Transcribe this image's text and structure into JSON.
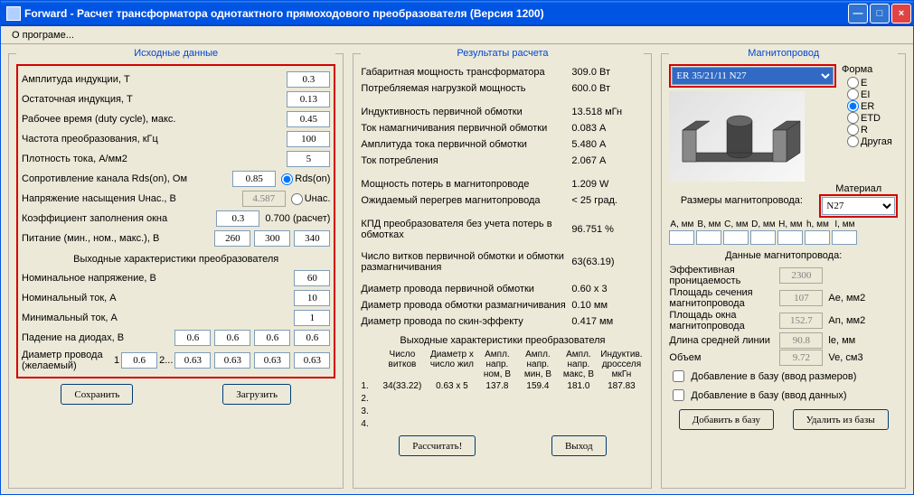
{
  "titlebar": "Forward - Расчет трансформатора однотактного прямоходового преобразователя (Версия 1200)",
  "menu": {
    "about": "О програме..."
  },
  "legends": {
    "input": "Исходные данные",
    "results": "Результаты расчета",
    "core": "Магнитопровод"
  },
  "input": {
    "rows": [
      {
        "label": "Амплитуда индукции, Т",
        "value": "0.3"
      },
      {
        "label": "Остаточная индукция, Т",
        "value": "0.13"
      },
      {
        "label": "Рабочее время (duty cycle), макс.",
        "value": "0.45"
      },
      {
        "label": "Частота преобразования, кГц",
        "value": "100"
      },
      {
        "label": "Плотность тока, А/мм2",
        "value": "5"
      },
      {
        "label": "Сопротивление канала Rds(on), Ом",
        "value": "0.85"
      },
      {
        "label": "Напряжение насыщения Uнас., В",
        "value": "4.587",
        "readonly": true
      },
      {
        "label": "Коэффициент заполнения окна",
        "value": "0.3",
        "extra": "0.700 (расчет)"
      },
      {
        "label": "Питание (мин., ном., макс.), В",
        "values": [
          "260",
          "300",
          "340"
        ]
      }
    ],
    "rds_label": "Rds(on)",
    "unas_label": "Uнас.",
    "out_head": "Выходные характеристики преобразователя",
    "out_rows": [
      {
        "label": "Номинальное напряжение, В",
        "values": [
          "60"
        ]
      },
      {
        "label": "Номинальный ток, А",
        "values": [
          "10"
        ]
      },
      {
        "label": "Минимальный ток, А",
        "values": [
          "1"
        ]
      },
      {
        "label": "Падение на диодах, В",
        "values": [
          "0.6",
          "0.6",
          "0.6",
          "0.6"
        ]
      }
    ],
    "wire": {
      "label": "Диаметр провода (желаемый)",
      "n1": "1",
      "v1": "0.6",
      "n2": "2...",
      "vals": [
        "0.63",
        "0.63",
        "0.63",
        "0.63"
      ]
    }
  },
  "results": {
    "rows1": [
      {
        "l": "Габаритная мощность трансформатора",
        "v": "309.0 Вт"
      },
      {
        "l": "Потребляемая нагрузкой мощность",
        "v": "600.0 Вт"
      }
    ],
    "rows2": [
      {
        "l": "Индуктивность первичной обмотки",
        "v": "13.518 мГн"
      },
      {
        "l": "Ток намагничивания первичной обмотки",
        "v": "0.083 А"
      },
      {
        "l": "Амплитуда тока первичной обмотки",
        "v": "5.480 А"
      },
      {
        "l": "Ток потребления",
        "v": "2.067 А"
      }
    ],
    "rows3": [
      {
        "l": "Мощность потерь в магнитопроводе",
        "v": "1.209 W"
      },
      {
        "l": "Ожидаемый перегрев магнитопровода",
        "v": "< 25 град."
      }
    ],
    "rows4": [
      {
        "l": "КПД преобразователя без учета потерь в обмотках",
        "v": "96.751 %"
      }
    ],
    "rows5": [
      {
        "l": "Число витков первичной обмотки и обмотки размагничивания",
        "v": "63(63.19)"
      }
    ],
    "rows6": [
      {
        "l": "Диаметр провода первичной обмотки",
        "v": "0.60 x 3"
      },
      {
        "l": "Диаметр провода обмотки размагничивания",
        "v": "0.10 мм"
      },
      {
        "l": "Диаметр провода по скин-эффекту",
        "v": "0.417 мм"
      }
    ],
    "out_head": "Выходные характеристики преобразователя",
    "tbl_head": [
      "",
      "Число витков",
      "Диаметр x число жил",
      "Ампл. напр. ном, В",
      "Ампл. напр. мин, В",
      "Ампл. напр. макс, В",
      "Индуктив. дросселя мкГн"
    ],
    "tbl_rows": [
      [
        "1.",
        "34(33.22)",
        "0.63 x 5",
        "137.8",
        "159.4",
        "181.0",
        "187.83"
      ],
      [
        "2.",
        "",
        "",
        "",
        "",
        "",
        ""
      ],
      [
        "3.",
        "",
        "",
        "",
        "",
        "",
        ""
      ],
      [
        "4.",
        "",
        "",
        "",
        "",
        "",
        ""
      ]
    ]
  },
  "core": {
    "select": "ER 35/21/11 N27",
    "shape_label": "Форма",
    "shapes": [
      "E",
      "EI",
      "ER",
      "ETD",
      "R",
      "Другая"
    ],
    "shape_sel": "ER",
    "mat_label": "Материал",
    "material": "N27",
    "dims_label": "Размеры магнитопровода:",
    "dims_head": [
      "A, мм",
      "B, мм",
      "C, мм",
      "D, мм",
      "H, мм",
      "h, мм",
      "I, мм"
    ],
    "data_label": "Данные магнитопровода:",
    "params": [
      {
        "l": "Эффективная проницаемость",
        "v": "2300",
        "u": ""
      },
      {
        "l": "Площадь сечения магнитопровода",
        "v": "107",
        "u": "Ae, мм2"
      },
      {
        "l": "Площадь окна магнитопровода",
        "v": "152.7",
        "u": "An, мм2"
      },
      {
        "l": "Длина средней линии",
        "v": "90.8",
        "u": "le, мм"
      },
      {
        "l": "Объем",
        "v": "9.72",
        "u": "Ve, см3"
      }
    ],
    "chk1": "Добавление в базу (ввод размеров)",
    "chk2": "Добавление в базу (ввод данных)",
    "btn_add": "Добавить в базу",
    "btn_del": "Удалить из базы"
  },
  "buttons": {
    "save": "Сохранить",
    "load": "Загрузить",
    "calc": "Рассчитать!",
    "exit": "Выход"
  }
}
